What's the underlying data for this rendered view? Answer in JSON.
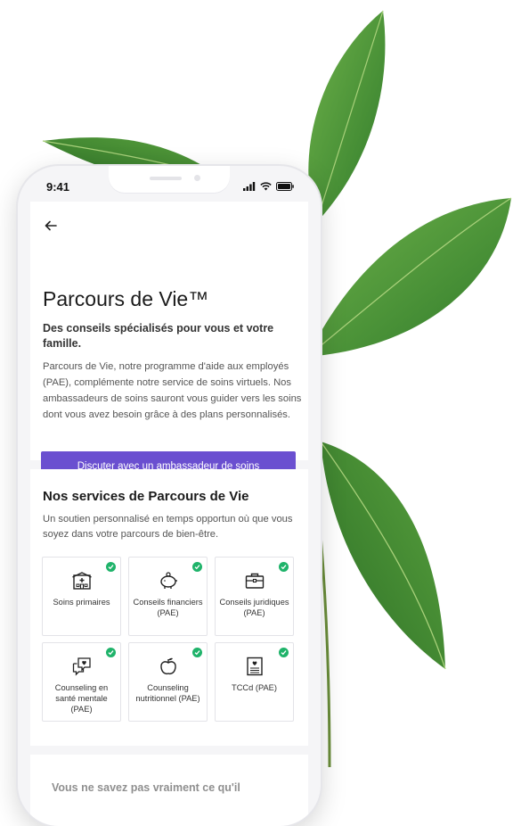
{
  "status_bar": {
    "time": "9:41"
  },
  "header": {
    "back_icon": "arrow-left-icon"
  },
  "hero": {
    "title": "Parcours de Vie™",
    "subtitle": "Des conseils spécialisés pour vous et votre famille.",
    "body": "Parcours de Vie, notre programme d'aide aux employés (PAE), complémente notre service de soins virtuels. Nos ambassadeurs de soins sauront vous guider vers les soins dont vous avez besoin grâce à des plans personnalisés.",
    "cta_label": "Discuter avec un ambassadeur de soins"
  },
  "services": {
    "title": "Nos services de Parcours de Vie",
    "subtitle": "Un soutien personnalisé en temps opportun où que vous soyez dans votre parcours de bien-être.",
    "items": [
      {
        "label": "Soins primaires",
        "icon": "clinic-icon"
      },
      {
        "label": "Conseils financiers (PAE)",
        "icon": "piggy-bank-icon"
      },
      {
        "label": "Conseils juridiques (PAE)",
        "icon": "briefcase-icon"
      },
      {
        "label": "Counseling en santé mentale (PAE)",
        "icon": "chat-heart-icon"
      },
      {
        "label": "Counseling nutritionnel (PAE)",
        "icon": "apple-icon"
      },
      {
        "label": "TCCd (PAE)",
        "icon": "document-heart-icon"
      }
    ]
  },
  "teaser": {
    "text": "Vous ne savez pas vraiment ce qu'il"
  },
  "colors": {
    "accent": "#6a4fd0",
    "check": "#1fb36a",
    "leaf": "#3f8f2f"
  }
}
